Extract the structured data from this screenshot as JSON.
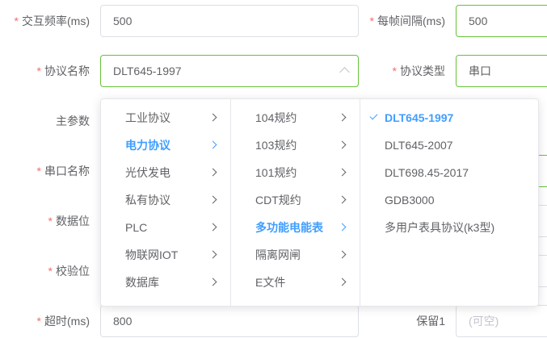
{
  "form": {
    "interaction_freq": {
      "label": "交互频率(ms)",
      "value": "500"
    },
    "frame_interval": {
      "label": "每帧间隔(ms)",
      "value": "500"
    },
    "protocol_name": {
      "label": "协议名称",
      "value": "DLT645-1997"
    },
    "protocol_type": {
      "label": "协议类型",
      "value": "串口"
    },
    "main_param": {
      "label": "主参数"
    },
    "serial_name": {
      "label": "串口名称"
    },
    "data_bits": {
      "label": "数据位"
    },
    "parity": {
      "label": "校验位"
    },
    "timeout": {
      "label": "超时(ms)",
      "value": "800"
    },
    "reserved1": {
      "label": "保留1",
      "placeholder": "(可空)"
    }
  },
  "cascader": {
    "level1": [
      "工业协议",
      "电力协议",
      "光伏发电",
      "私有协议",
      "PLC",
      "物联网IOT",
      "数据库"
    ],
    "level2": [
      "104规约",
      "103规约",
      "101规约",
      "CDT规约",
      "多功能电能表",
      "隔离网闸",
      "E文件"
    ],
    "level3": [
      "DLT645-1997",
      "DLT645-2007",
      "DLT698.45-2017",
      "GDB3000",
      "多用户表具协议(k3型)"
    ],
    "active_level1": "电力协议",
    "active_level2": "多功能电能表",
    "selected_level3": "DLT645-1997"
  },
  "colors": {
    "accent": "#409eff",
    "required": "#f56c6c",
    "valid": "#67c23a"
  }
}
